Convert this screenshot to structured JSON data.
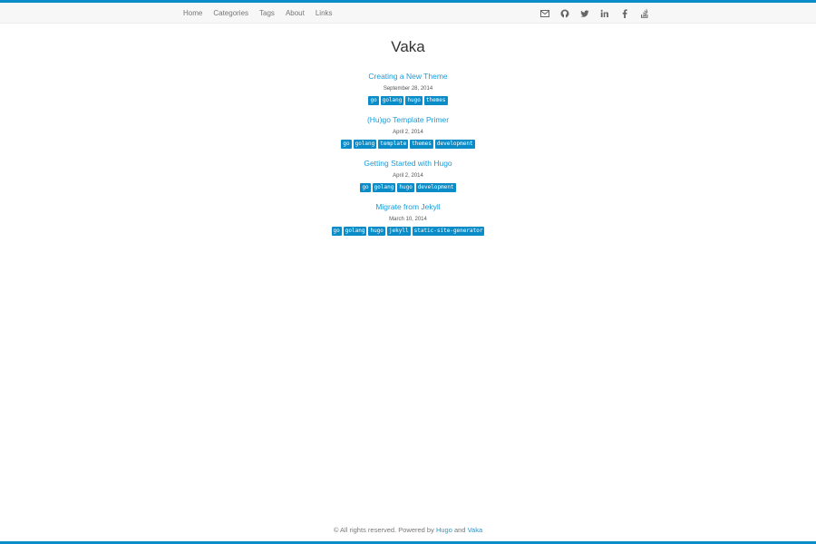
{
  "nav": {
    "links": [
      "Home",
      "Categories",
      "Tags",
      "About",
      "Links"
    ],
    "icons": [
      "envelope-icon",
      "github-icon",
      "twitter-icon",
      "linkedin-icon",
      "facebook-icon",
      "stackoverflow-icon"
    ]
  },
  "site": {
    "title": "Vaka"
  },
  "posts": [
    {
      "title": "Creating a New Theme",
      "date": "September 28, 2014",
      "tags": [
        "go",
        "golang",
        "hugo",
        "themes"
      ]
    },
    {
      "title": "(Hu)go Template Primer",
      "date": "April 2, 2014",
      "tags": [
        "go",
        "golang",
        "template",
        "themes",
        "development"
      ]
    },
    {
      "title": "Getting Started with Hugo",
      "date": "April 2, 2014",
      "tags": [
        "go",
        "golang",
        "hugo",
        "development"
      ]
    },
    {
      "title": "Migrate from Jekyll",
      "date": "March 10, 2014",
      "tags": [
        "go",
        "golang",
        "hugo",
        "jekyll",
        "static-site-generator"
      ]
    }
  ],
  "footer": {
    "text": "© All rights reserved. Powered by",
    "hugo_link": "Hugo",
    "and": "and",
    "vaka_link": "Vaka"
  },
  "colors": {
    "accent": "#0a8cc8",
    "link": "#1a9ad9"
  }
}
